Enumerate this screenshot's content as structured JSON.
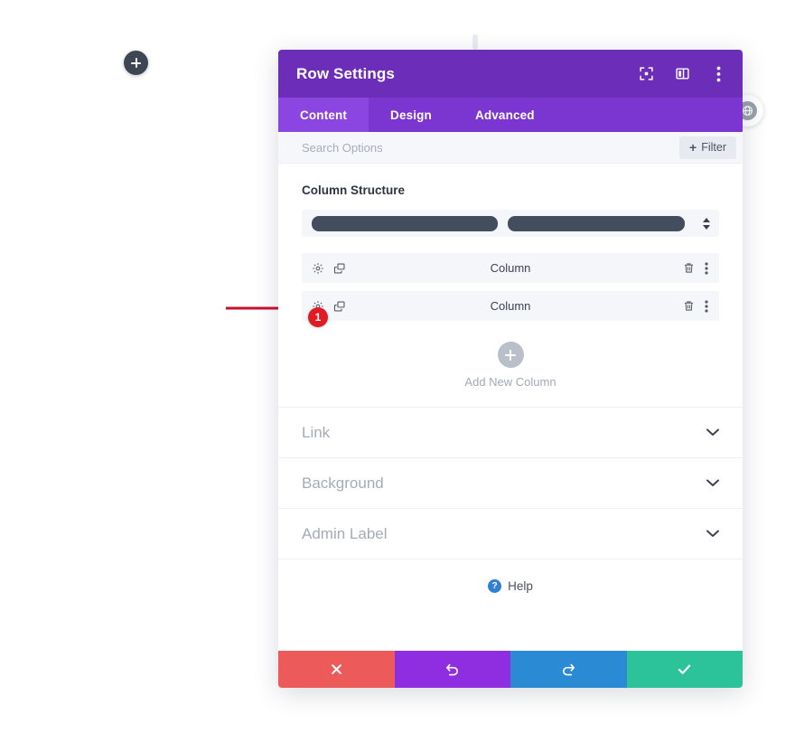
{
  "panel": {
    "title": "Row Settings",
    "header_icons": [
      {
        "name": "focus-mode-icon",
        "label": "Focus Mode"
      },
      {
        "name": "panel-layout-icon",
        "label": "Panel Layout"
      },
      {
        "name": "more-options-icon",
        "label": "More Options"
      }
    ],
    "tabs": [
      {
        "label": "Content",
        "active": true
      },
      {
        "label": "Design",
        "active": false
      },
      {
        "label": "Advanced",
        "active": false
      }
    ],
    "search": {
      "placeholder": "Search Options",
      "value": ""
    },
    "filter": {
      "label": "Filter",
      "plus": "+"
    },
    "column_structure": {
      "heading": "Column Structure",
      "bars": [
        {
          "width_percent": 48
        },
        {
          "width_percent": 52
        }
      ]
    },
    "columns": [
      {
        "label": "Column"
      },
      {
        "label": "Column"
      }
    ],
    "column_row_icons": {
      "settings": "gear-icon",
      "duplicate": "duplicate-icon",
      "delete": "trash-icon",
      "more": "more-options-icon"
    },
    "add_new_column": {
      "label": "Add New Column",
      "plus": "+"
    },
    "accordions": [
      {
        "label": "Link"
      },
      {
        "label": "Background"
      },
      {
        "label": "Admin Label"
      }
    ],
    "help": {
      "label": "Help",
      "glyph": "?"
    },
    "footer_buttons": [
      {
        "name": "cancel-button",
        "icon": "close-icon",
        "color": "#ec5a5a"
      },
      {
        "name": "undo-button",
        "icon": "undo-icon",
        "color": "#8e2ee0"
      },
      {
        "name": "redo-button",
        "icon": "redo-icon",
        "color": "#2a8ad4"
      },
      {
        "name": "save-button",
        "icon": "check-icon",
        "color": "#2cc39b"
      }
    ],
    "colors": {
      "header": "#6c2eb9",
      "tab_bar": "#7b35d1",
      "tab_active": "#8b45e0",
      "structure_bar": "#424e5e",
      "badge": "#e01b24"
    }
  },
  "canvas": {
    "add_section_button": {
      "plus": "+"
    },
    "annotation_badge": "1"
  }
}
